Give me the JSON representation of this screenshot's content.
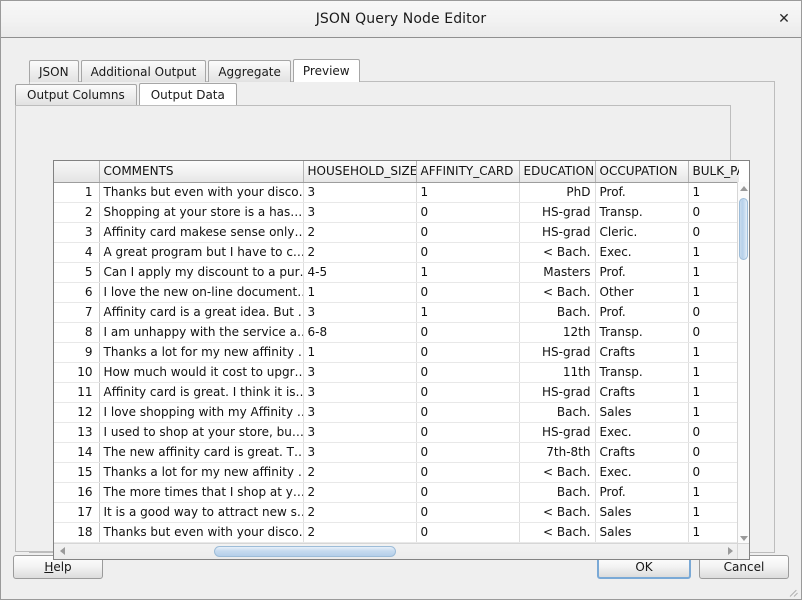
{
  "window": {
    "title": "JSON Query Node Editor",
    "close_icon": "close-icon",
    "close_glyph": "✕"
  },
  "tabs": {
    "outer": [
      {
        "label": "JSON",
        "selected": false
      },
      {
        "label": "Additional Output",
        "selected": false
      },
      {
        "label": "Aggregate",
        "selected": false
      },
      {
        "label": "Preview",
        "selected": true
      }
    ],
    "inner": [
      {
        "label": "Output Columns",
        "selected": false
      },
      {
        "label": "Output Data",
        "selected": true
      }
    ]
  },
  "table": {
    "columns": [
      {
        "key": "rownum",
        "label": "",
        "align": "right"
      },
      {
        "key": "comments",
        "label": "COMMENTS",
        "align": "left"
      },
      {
        "key": "household_size",
        "label": "HOUSEHOLD_SIZE",
        "align": "left"
      },
      {
        "key": "affinity_card",
        "label": "AFFINITY_CARD",
        "align": "left"
      },
      {
        "key": "education",
        "label": "EDUCATION",
        "align": "right"
      },
      {
        "key": "occupation",
        "label": "OCCUPATION",
        "align": "left"
      },
      {
        "key": "bulk_pack",
        "label": "BULK_PA",
        "align": "left"
      }
    ],
    "rows": [
      {
        "rownum": "1",
        "comments": "Thanks but even with your disco…",
        "household_size": "3",
        "affinity_card": "1",
        "education": "PhD",
        "occupation": "Prof.",
        "bulk_pack": "1"
      },
      {
        "rownum": "2",
        "comments": "Shopping at your store is a has…",
        "household_size": "3",
        "affinity_card": "0",
        "education": "HS-grad",
        "occupation": "Transp.",
        "bulk_pack": "0"
      },
      {
        "rownum": "3",
        "comments": "Affinity card makese sense only…",
        "household_size": "2",
        "affinity_card": "0",
        "education": "HS-grad",
        "occupation": "Cleric.",
        "bulk_pack": "0"
      },
      {
        "rownum": "4",
        "comments": "A great program but I have to c…",
        "household_size": "2",
        "affinity_card": "0",
        "education": "< Bach.",
        "occupation": "Exec.",
        "bulk_pack": "1"
      },
      {
        "rownum": "5",
        "comments": "Can I apply my discount to a pur…",
        "household_size": "4-5",
        "affinity_card": "1",
        "education": "Masters",
        "occupation": "Prof.",
        "bulk_pack": "1"
      },
      {
        "rownum": "6",
        "comments": "I love the new on-line document…",
        "household_size": "1",
        "affinity_card": "0",
        "education": "< Bach.",
        "occupation": "Other",
        "bulk_pack": "1"
      },
      {
        "rownum": "7",
        "comments": "Affinity card is a great idea. But …",
        "household_size": "3",
        "affinity_card": "1",
        "education": "Bach.",
        "occupation": "Prof.",
        "bulk_pack": "0"
      },
      {
        "rownum": "8",
        "comments": "I am unhappy with the service a…",
        "household_size": "6-8",
        "affinity_card": "0",
        "education": "12th",
        "occupation": "Transp.",
        "bulk_pack": "0"
      },
      {
        "rownum": "9",
        "comments": "Thanks a lot for my new affinity …",
        "household_size": "1",
        "affinity_card": "0",
        "education": "HS-grad",
        "occupation": "Crafts",
        "bulk_pack": "1"
      },
      {
        "rownum": "10",
        "comments": "How much would it cost to upgr…",
        "household_size": "3",
        "affinity_card": "0",
        "education": "11th",
        "occupation": "Transp.",
        "bulk_pack": "1"
      },
      {
        "rownum": "11",
        "comments": "Affinity card is great. I think it is…",
        "household_size": "3",
        "affinity_card": "0",
        "education": "HS-grad",
        "occupation": "Crafts",
        "bulk_pack": "1"
      },
      {
        "rownum": "12",
        "comments": "I love shopping with my Affinity …",
        "household_size": "3",
        "affinity_card": "0",
        "education": "Bach.",
        "occupation": "Sales",
        "bulk_pack": "1"
      },
      {
        "rownum": "13",
        "comments": "I used to shop at your store, bu…",
        "household_size": "3",
        "affinity_card": "0",
        "education": "HS-grad",
        "occupation": "Exec.",
        "bulk_pack": "0"
      },
      {
        "rownum": "14",
        "comments": "The new affinity card is great. T…",
        "household_size": "3",
        "affinity_card": "0",
        "education": "7th-8th",
        "occupation": "Crafts",
        "bulk_pack": "0"
      },
      {
        "rownum": "15",
        "comments": "Thanks a lot for my new affinity …",
        "household_size": "2",
        "affinity_card": "0",
        "education": "< Bach.",
        "occupation": "Exec.",
        "bulk_pack": "0"
      },
      {
        "rownum": "16",
        "comments": "The more times that I shop at y…",
        "household_size": "2",
        "affinity_card": "0",
        "education": "Bach.",
        "occupation": "Prof.",
        "bulk_pack": "1"
      },
      {
        "rownum": "17",
        "comments": "It is a good way to attract new s…",
        "household_size": "2",
        "affinity_card": "0",
        "education": "< Bach.",
        "occupation": "Sales",
        "bulk_pack": "1"
      },
      {
        "rownum": "18",
        "comments": "Thanks but even with your disco…",
        "household_size": "2",
        "affinity_card": "0",
        "education": "< Bach.",
        "occupation": "Sales",
        "bulk_pack": "1"
      }
    ]
  },
  "scrollbars": {
    "vertical": {
      "up_icon": "scroll-up-arrow-icon",
      "down_icon": "scroll-down-arrow-icon"
    },
    "horizontal": {
      "left_icon": "scroll-left-arrow-icon",
      "right_icon": "scroll-right-arrow-icon"
    }
  },
  "buttons": {
    "help": {
      "mnemonic": "H",
      "rest": "elp"
    },
    "ok": "OK",
    "cancel": "Cancel"
  },
  "colors": {
    "window_bg": "#efefef",
    "titlebar_bg": "#f2f2f2",
    "selected_tab_bg": "#ffffff",
    "scroll_thumb": "#b6d0ea",
    "focus_border": "#7aa9d6"
  }
}
